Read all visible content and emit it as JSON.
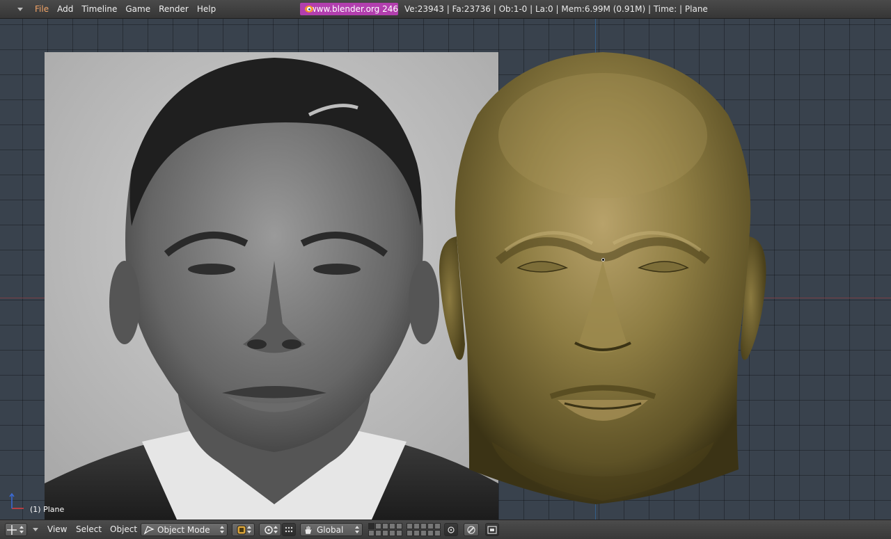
{
  "top_menu": {
    "items": [
      {
        "label": "File",
        "active": true
      },
      {
        "label": "Add",
        "active": false
      },
      {
        "label": "Timeline",
        "active": false
      },
      {
        "label": "Game",
        "active": false
      },
      {
        "label": "Render",
        "active": false
      },
      {
        "label": "Help",
        "active": false
      }
    ],
    "website_button": "www.blender.org 246",
    "stats": "Ve:23943 | Fa:23736 | Ob:1-0 | La:0  | Mem:6.99M (0.91M)  | Time: | Plane"
  },
  "viewport": {
    "active_object_label": "(1) Plane",
    "background_image": "black-and-white portrait photo reference",
    "model": "sculpted head mesh",
    "model_color": "#8a7a42"
  },
  "bottom_bar": {
    "menus": [
      "View",
      "Select",
      "Object"
    ],
    "mode": "Object Mode",
    "orientation": "Global",
    "icons": [
      "viewport-editor-icon",
      "draw-type-icon",
      "pivot-icon",
      "manipulator-hand-icon",
      "lock-icon",
      "render-icon"
    ]
  },
  "colors": {
    "header_bg": "#3f3f3f",
    "viewport_bg": "#39424d",
    "active_menu": "#f3a468",
    "website_button_bg": "#b23fae",
    "x_axis": "#7a3f44",
    "y_axis": "#335e87"
  }
}
